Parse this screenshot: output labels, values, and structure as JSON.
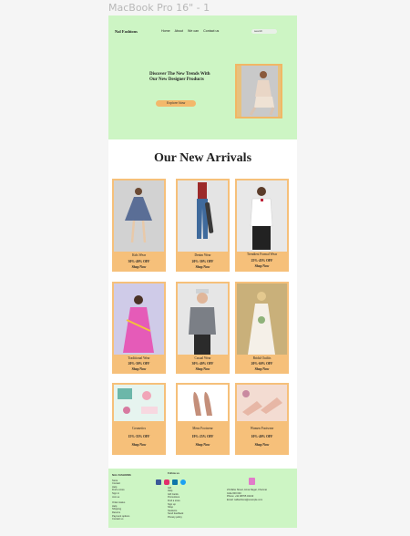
{
  "frame_label": "MacBook Pro 16\" - 1",
  "header": {
    "brand": "Nal Fashions",
    "nav": [
      "Home",
      "About",
      "We can",
      "Contact us"
    ],
    "search_placeholder": "search"
  },
  "hero": {
    "headline": "Discover The New Trends With Our New Designer Products",
    "cta": "Explore Now"
  },
  "section_title": "Our New Arrivals",
  "products": [
    {
      "category": "Kids Wear",
      "offer": "30%-40% OFF",
      "cta": "Shop Now"
    },
    {
      "category": "Denim Wear",
      "offer": "20%-30% OFF",
      "cta": "Shop Now"
    },
    {
      "category": "Trendiest Formal Wear",
      "offer": "25%-45% OFF",
      "cta": "Shop Now"
    },
    {
      "category": "Traditional Wear",
      "offer": "20%-30% OFF",
      "cta": "Shop Now"
    },
    {
      "category": "Casual Wear",
      "offer": "30%-40% OFF",
      "cta": "Shop Now"
    },
    {
      "category": "Bridal Outfits",
      "offer": "20%-60% OFF",
      "cta": "Shop Now"
    },
    {
      "category": "Cosmetics",
      "offer": "15%-35% OFF",
      "cta": "Shop Now"
    },
    {
      "category": "Mens Footwear",
      "offer": "19%-25% OFF",
      "cta": "Shop Now"
    },
    {
      "category": "Women Footwear",
      "offer": "10%-40% OFF",
      "cta": "Shop Now"
    }
  ],
  "footer": {
    "col1_title": "NAL FASHIONS",
    "col1_links": [
      "Store",
      "Contact",
      "Help",
      "Find a store",
      "Sign in",
      "Join us"
    ],
    "col1_links2": [
      "Order status",
      "Help",
      "Shipping",
      "Returns",
      "Payment options",
      "Contact us"
    ],
    "col2_title": "Follow us",
    "col2_links": [
      "Gift",
      "Help",
      "Gift Cards",
      "Promotions",
      "Find a store",
      "Sign up",
      "Shop",
      "Students",
      "Send feedback",
      "Privacy policy"
    ],
    "contact": [
      "23 Mahe Street, Anna Nagar, Chennai",
      "India 600 040",
      "Phone: +91 98765 43210",
      "Email: nalfashions@example.com"
    ],
    "social_colors": [
      "#3b5998",
      "#e1306c",
      "#0e76a8",
      "#1da1f2"
    ],
    "accent": "#f3b86b",
    "bg": "#cdf5c4"
  },
  "colors": {
    "mint": "#cdf5c4",
    "card": "#f6c07a",
    "button": "#f3b86b"
  }
}
